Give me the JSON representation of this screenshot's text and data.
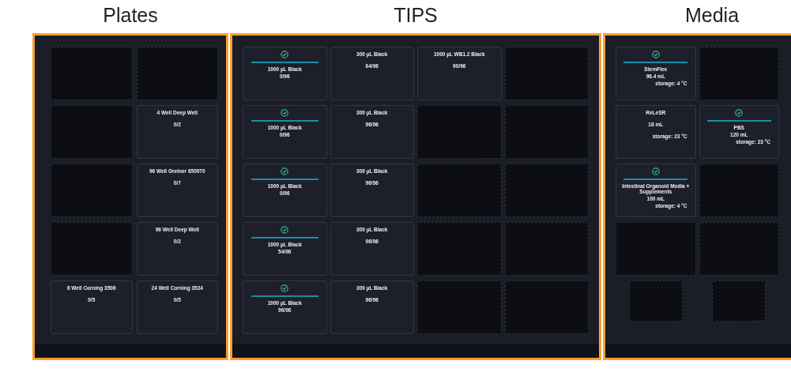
{
  "panels": [
    {
      "title": "Plates",
      "slots": [
        {
          "kind": "empty"
        },
        {
          "kind": "empty"
        },
        {
          "kind": "empty"
        },
        {
          "kind": "item",
          "checked": false,
          "name": "4 Well Deep Well",
          "count": "0/2"
        },
        {
          "kind": "empty"
        },
        {
          "kind": "item",
          "checked": false,
          "name": "96 Well Greiner 650970",
          "count": "0/7"
        },
        {
          "kind": "empty"
        },
        {
          "kind": "item",
          "checked": false,
          "name": "96 Well Deep Well",
          "count": "0/2"
        },
        {
          "kind": "item",
          "checked": false,
          "name": "6 Well Corning 3506",
          "count": "0/5"
        },
        {
          "kind": "item",
          "checked": false,
          "name": "24 Well Corning 3524",
          "count": "0/5"
        }
      ]
    },
    {
      "title": "TIPS",
      "slots": [
        {
          "kind": "item",
          "checked": true,
          "name": "1000 µL Black",
          "count": "0/96"
        },
        {
          "kind": "item",
          "checked": false,
          "name": "300 µL Black",
          "count": "64/96"
        },
        {
          "kind": "item",
          "checked": false,
          "name": "1000 µL WB1.2 Black",
          "count": "90/96"
        },
        {
          "kind": "empty"
        },
        {
          "kind": "item",
          "checked": true,
          "name": "1000 µL Black",
          "count": "0/96"
        },
        {
          "kind": "item",
          "checked": false,
          "name": "300 µL Black",
          "count": "96/96"
        },
        {
          "kind": "empty"
        },
        {
          "kind": "empty"
        },
        {
          "kind": "item",
          "checked": true,
          "name": "1000 µL Black",
          "count": "0/96"
        },
        {
          "kind": "item",
          "checked": false,
          "name": "300 µL Black",
          "count": "96/96"
        },
        {
          "kind": "empty"
        },
        {
          "kind": "empty"
        },
        {
          "kind": "item",
          "checked": true,
          "name": "1000 µL Black",
          "count": "54/96"
        },
        {
          "kind": "item",
          "checked": false,
          "name": "300 µL Black",
          "count": "96/96"
        },
        {
          "kind": "empty"
        },
        {
          "kind": "empty"
        },
        {
          "kind": "item",
          "checked": true,
          "name": "1000 µL Black",
          "count": "96/96"
        },
        {
          "kind": "item",
          "checked": false,
          "name": "300 µL Black",
          "count": "96/96"
        },
        {
          "kind": "empty"
        },
        {
          "kind": "empty"
        }
      ]
    },
    {
      "title": "Media",
      "slots": [
        {
          "kind": "item",
          "checked": true,
          "name": "StemFlex",
          "count": "96.4 mL",
          "storage": "storage: 4 °C"
        },
        {
          "kind": "empty"
        },
        {
          "kind": "item",
          "checked": false,
          "name": "ReLeSR",
          "count": "18 mL",
          "storage": "storage: 23 °C"
        },
        {
          "kind": "item",
          "checked": true,
          "name": "PBS",
          "count": "120 mL",
          "storage": "storage: 23 °C"
        },
        {
          "kind": "item",
          "checked": true,
          "name": "Intestinal Organoid Media + Supplements",
          "count": "100 mL",
          "storage": "storage: 4 °C"
        },
        {
          "kind": "empty"
        },
        {
          "kind": "empty"
        },
        {
          "kind": "empty"
        },
        {
          "kind": "small-empty"
        },
        {
          "kind": "small-empty"
        }
      ]
    }
  ]
}
